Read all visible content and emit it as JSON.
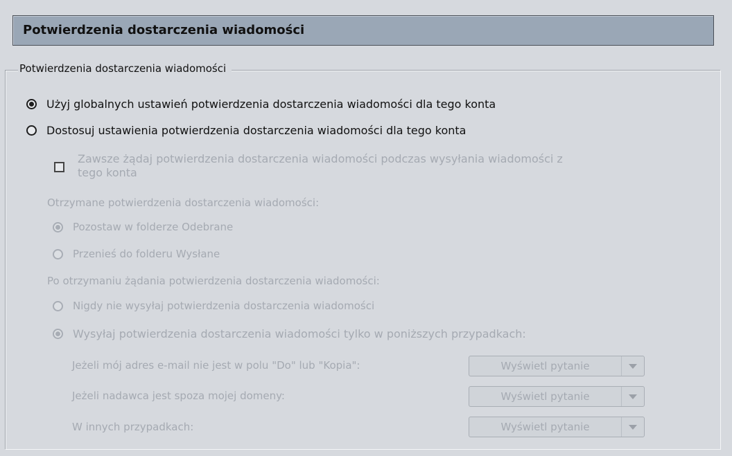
{
  "header": {
    "title": "Potwierdzenia dostarczenia wiadomości"
  },
  "group": {
    "legend": "Potwierdzenia dostarczenia wiadomości",
    "option_global": "Użyj globalnych ustawień potwierdzenia dostarczenia wiadomości dla tego konta",
    "option_custom": "Dostosuj ustawienia potwierdzenia dostarczenia wiadomości dla tego konta",
    "always_request_line1": "Zawsze żądaj potwierdzenia dostarczenia wiadomości podczas wysyłania wiadomości z",
    "always_request_line2": "tego konta",
    "received_label": "Otrzymane potwierdzenia dostarczenia wiadomości:",
    "leave_inbox": "Pozostaw w folderze Odebrane",
    "move_sent": "Przenieś do folderu Wysłane",
    "on_request_label": "Po otrzymaniu żądania potwierdzenia dostarczenia wiadomości:",
    "never_send": "Nigdy nie wysyłaj potwierdzenia dostarczenia wiadomości",
    "send_only": "Wysyłaj potwierdzenia dostarczenia wiadomości tylko w poniższych przypadkach:",
    "cases": [
      {
        "label": "Jeżeli mój adres e-mail nie jest w polu \"Do\" lub \"Kopia\":",
        "value": "Wyświetl pytanie"
      },
      {
        "label": "Jeżeli nadawca jest spoza mojej domeny:",
        "value": "Wyświetl pytanie"
      },
      {
        "label": "W innych przypadkach:",
        "value": "Wyświetl pytanie"
      }
    ]
  }
}
